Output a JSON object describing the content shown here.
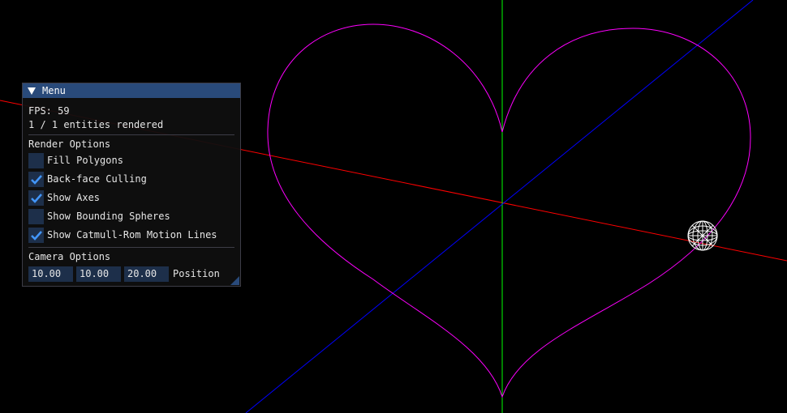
{
  "window": {
    "title": "Menu"
  },
  "stats": {
    "fps": "FPS: 59",
    "entities": "1 / 1 entities rendered"
  },
  "render_options": {
    "header": "Render Options",
    "items": [
      {
        "label": "Fill Polygons",
        "checked": false
      },
      {
        "label": "Back-face Culling",
        "checked": true
      },
      {
        "label": "Show Axes",
        "checked": true
      },
      {
        "label": "Show Bounding Spheres",
        "checked": false
      },
      {
        "label": "Show Catmull-Rom Motion Lines",
        "checked": true
      }
    ]
  },
  "camera_options": {
    "header": "Camera Options",
    "position": [
      "10.00",
      "10.00",
      "20.00"
    ],
    "position_label": "Position"
  },
  "colors": {
    "background": "#000000",
    "x_axis": "#ff0000",
    "y_axis": "#00ff00",
    "z_axis": "#0000ff",
    "motion_curve": "#ff00ff",
    "sphere": "#ffffff",
    "titlebar": "#294a7a",
    "checkmark": "#4296fa",
    "frame_bg": "#1d2f4a"
  }
}
